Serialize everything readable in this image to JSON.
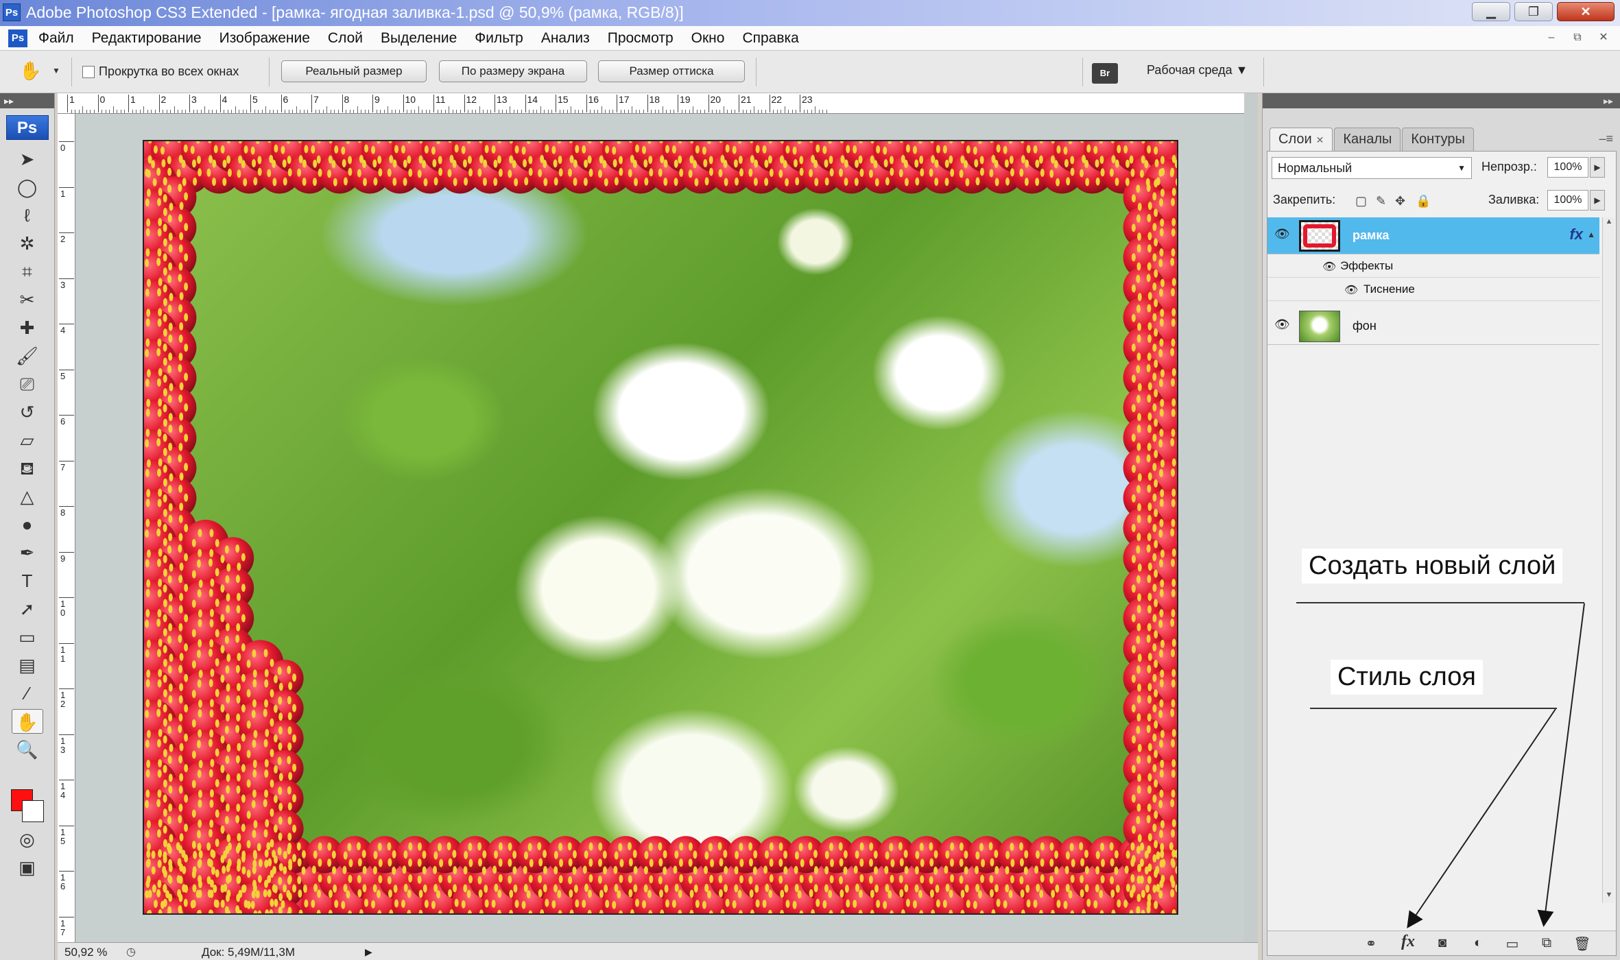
{
  "window": {
    "title": "Adobe Photoshop CS3 Extended - [рамка- ягодная заливка-1.psd @ 50,9% (рамка, RGB/8)]",
    "app_badge": "Ps",
    "btn_minimize": "▁",
    "btn_restore": "❐",
    "btn_close": "✕"
  },
  "menubar": {
    "items": [
      "Файл",
      "Редактирование",
      "Изображение",
      "Слой",
      "Выделение",
      "Фильтр",
      "Анализ",
      "Просмотр",
      "Окно",
      "Справка"
    ],
    "mdi_minimize": "–",
    "mdi_restore": "⧉",
    "mdi_close": "✕"
  },
  "options": {
    "tool_icon": "hand-icon",
    "scroll_all_label": "Прокрутка во всех окнах",
    "actual_pixels": "Реальный размер",
    "fit_screen": "По размеру экрана",
    "print_size": "Размер оттиска",
    "bridge_label": "Br",
    "workspace_label": "Рабочая среда ▼"
  },
  "tools": {
    "badge": "Ps",
    "collapse": "▸▸",
    "icons": [
      "move-icon",
      "marquee-icon",
      "lasso-icon",
      "magic-wand-icon",
      "crop-icon",
      "slice-icon",
      "healing-icon",
      "brush-icon",
      "stamp-icon",
      "history-brush-icon",
      "eraser-icon",
      "fill-icon",
      "blur-icon",
      "dodge-icon",
      "pen-icon",
      "type-icon",
      "path-select-icon",
      "shape-icon",
      "notes-icon",
      "eyedropper-icon",
      "hand-icon",
      "zoom-icon",
      "quickmask-icon",
      "screen-mode-icon"
    ],
    "foreground_color": "#ff1010",
    "background_color": "#ffffff"
  },
  "ruler": {
    "top_labels": [
      "1",
      "0",
      "1",
      "2",
      "3",
      "4",
      "5",
      "6",
      "7",
      "8",
      "9",
      "10",
      "11",
      "12",
      "13",
      "14",
      "15",
      "16",
      "17",
      "18",
      "19",
      "20",
      "21",
      "22",
      "23"
    ],
    "left_labels": [
      "0",
      "1",
      "2",
      "3",
      "4",
      "5",
      "6",
      "7",
      "8",
      "9",
      "10",
      "11",
      "12",
      "13",
      "14",
      "15",
      "16",
      "17"
    ]
  },
  "status": {
    "zoom": "50,92 %",
    "doc_size": "Док: 5,49M/11,3M",
    "menu_arrow": "▶"
  },
  "layers_panel": {
    "collapse": "▸▸",
    "tabs": [
      {
        "label": "Слои",
        "close": "✕"
      },
      {
        "label": "Каналы"
      },
      {
        "label": "Контуры"
      }
    ],
    "blend_mode": "Нормальный",
    "opacity_label": "Непрозр.:",
    "opacity_value": "100%",
    "lock_label": "Закрепить:",
    "fill_label": "Заливка:",
    "fill_value": "100%",
    "layers": [
      {
        "name": "рамка",
        "fx": "fx",
        "selected": true
      },
      {
        "name": "фон",
        "selected": false
      }
    ],
    "effects_label": "Эффекты",
    "emboss_label": "Тиснение"
  },
  "annotations": {
    "new_layer": "Создать новый слой",
    "layer_style": "Стиль слоя"
  },
  "colors": {
    "selected_layer": "#52b9ec",
    "berry_red": "#e2192d",
    "seed_yellow": "#f2d23a"
  }
}
